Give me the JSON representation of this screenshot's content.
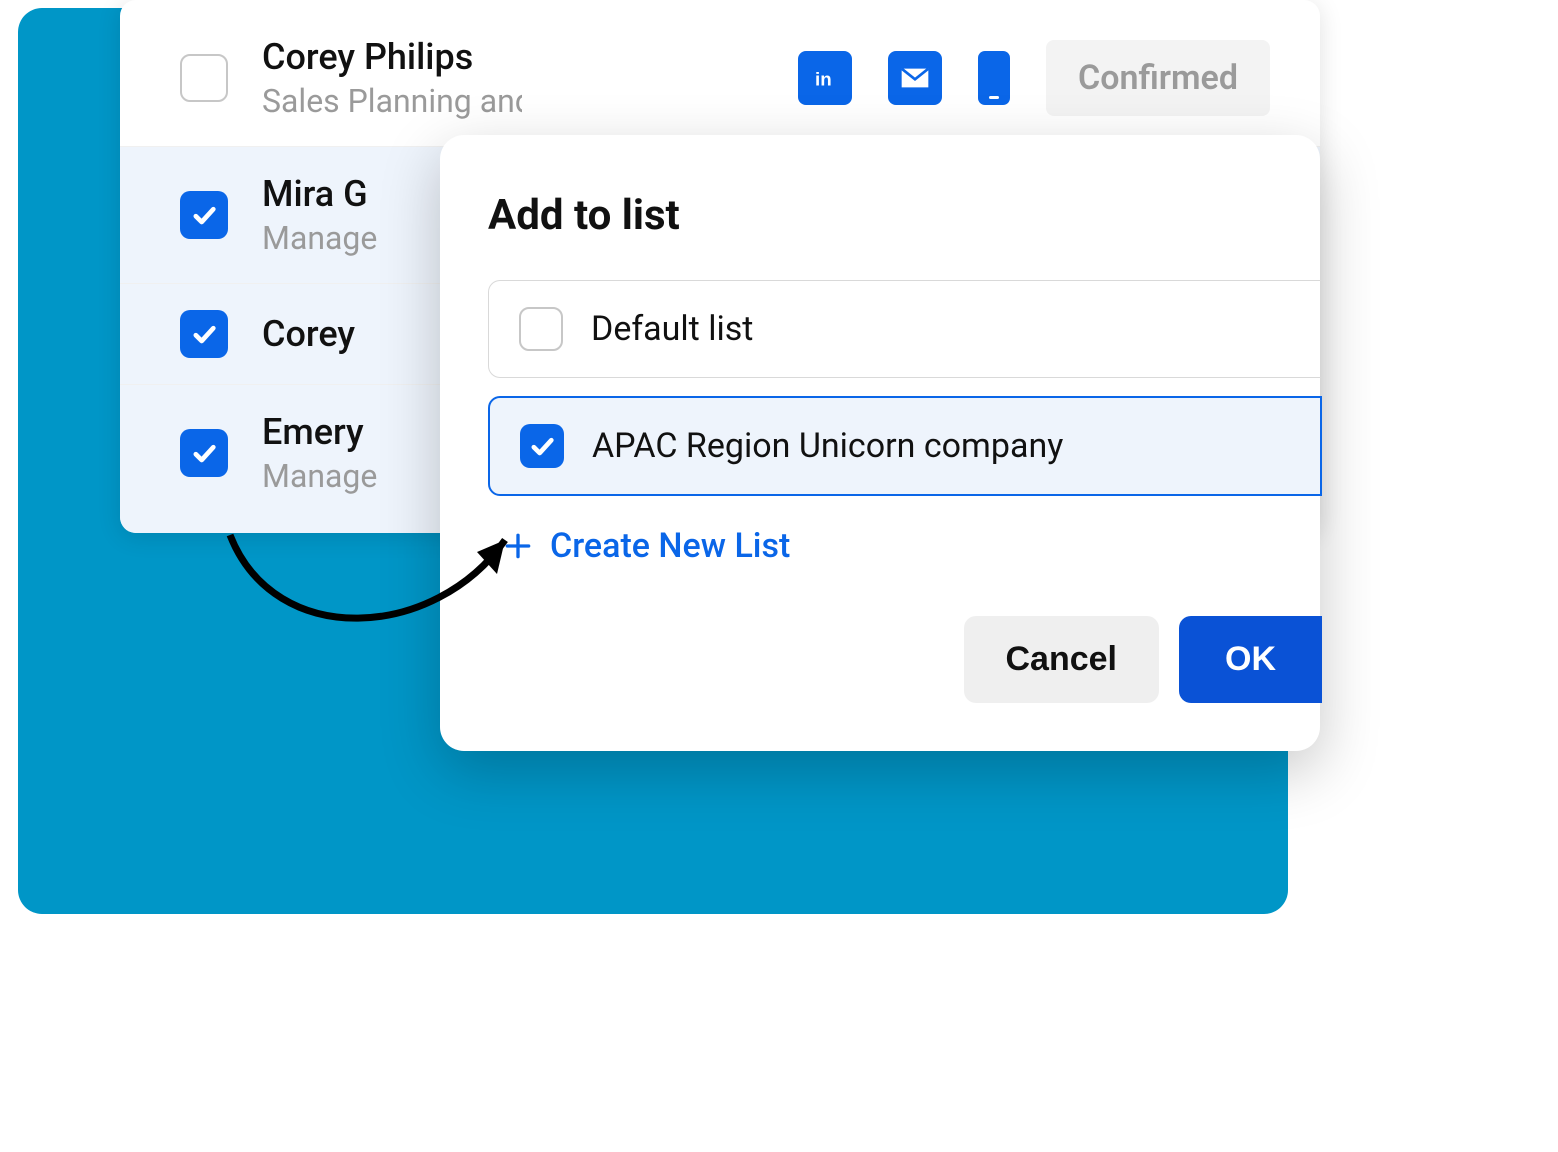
{
  "contacts": [
    {
      "name": "Corey Philips",
      "subtitle": "Sales Planning and",
      "selected": false
    },
    {
      "name": "Mira G",
      "subtitle": "Manage",
      "selected": true
    },
    {
      "name": "Corey",
      "subtitle": "",
      "selected": true
    },
    {
      "name": "Emery",
      "subtitle": "Manage",
      "selected": true
    }
  ],
  "status_label": "Confirmed",
  "dialog": {
    "title": "Add to list",
    "options": [
      {
        "label": "Default list",
        "checked": false
      },
      {
        "label": "APAC Region Unicorn company",
        "checked": true
      }
    ],
    "create_label": "Create New List",
    "cancel_label": "Cancel",
    "ok_label": "OK"
  },
  "colors": {
    "accent": "#0a66e8",
    "bg_teal": "#0096c7"
  }
}
